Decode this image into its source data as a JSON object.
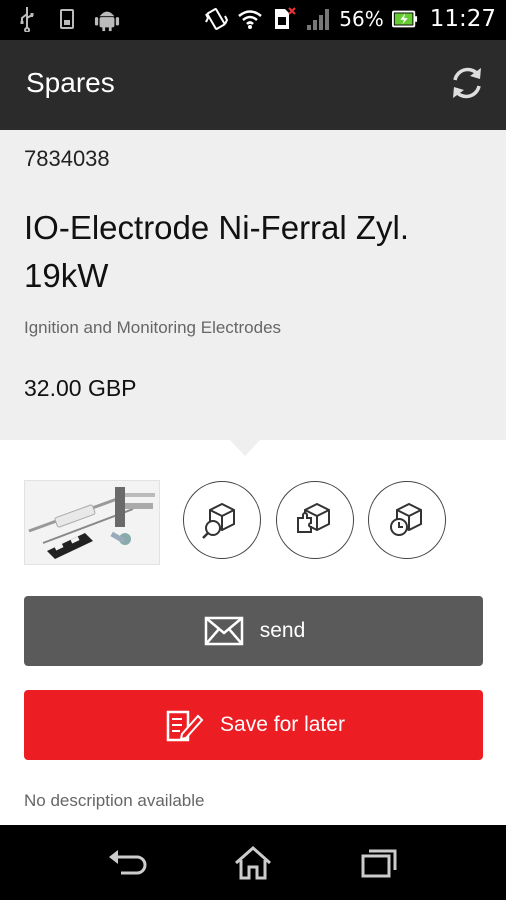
{
  "status_bar": {
    "battery_percent": "56%",
    "time": "11:27",
    "icons": [
      "usb-icon",
      "sd-card-icon",
      "android-icon",
      "vibrate-icon",
      "wifi-icon",
      "sim-icon",
      "signal-icon",
      "battery-charging-icon"
    ]
  },
  "app_bar": {
    "title": "Spares",
    "refresh_icon": "refresh-icon"
  },
  "product": {
    "part_number": "7834038",
    "name": "IO-Electrode Ni-Ferral Zyl. 19kW",
    "category": "Ignition and Monitoring Electrodes",
    "price": "32.00 GBP",
    "description": "No description available"
  },
  "actions": {
    "circles": [
      "box-check-icon",
      "box-puzzle-icon",
      "box-history-icon"
    ],
    "send_label": "send",
    "save_label": "Save for later"
  },
  "colors": {
    "app_bar": "#2b2b2b",
    "header_bg": "#efeff0",
    "send_button": "#5a5a5a",
    "save_button": "#ec1e24"
  },
  "nav_bar": [
    "back-icon",
    "home-icon",
    "recent-apps-icon"
  ]
}
